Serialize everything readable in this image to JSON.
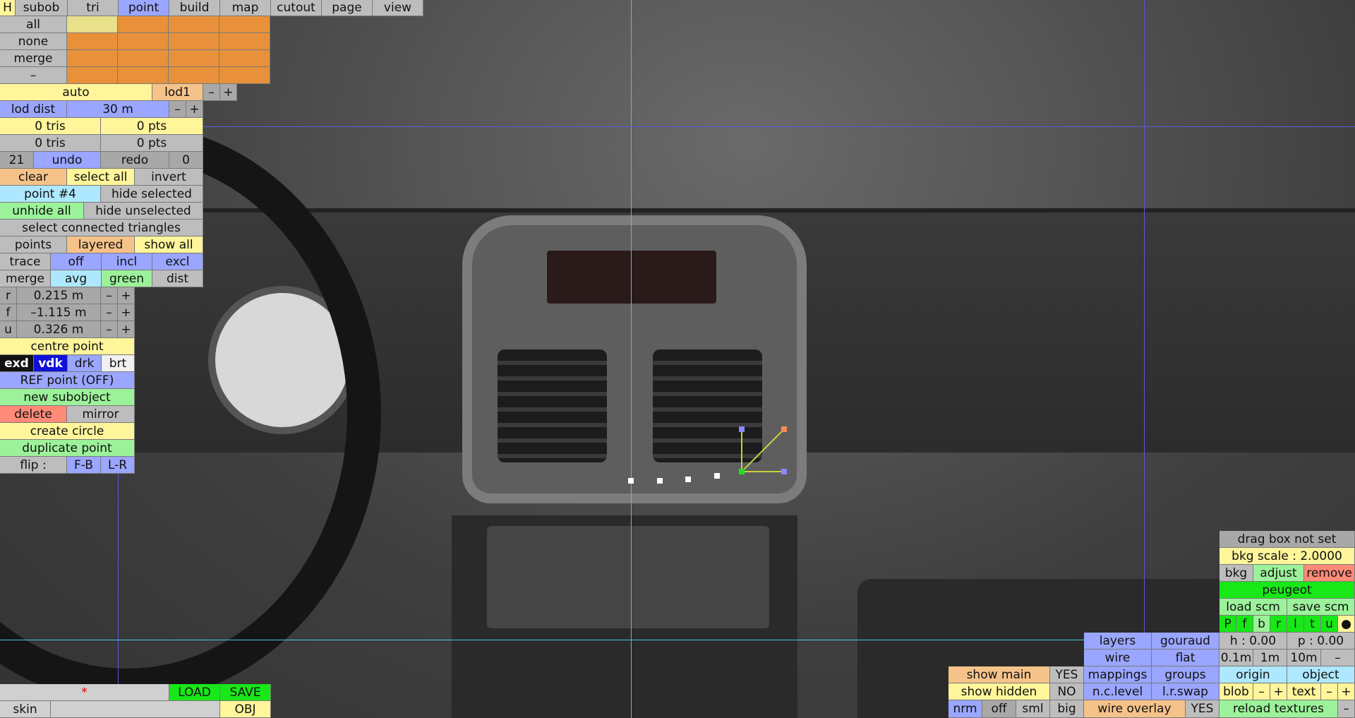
{
  "colors": {
    "cyan_guide": "#43c8d6",
    "blue_guide": "#5a5ad8",
    "point_green": "#22e022",
    "point_blue": "#8888ff",
    "point_orange": "#ff8a55",
    "line_yellow": "#c8d040"
  },
  "top_tabs": [
    "H",
    "subob",
    "tri",
    "point",
    "build",
    "map",
    "cutout",
    "page",
    "view"
  ],
  "sel_rows": [
    "all",
    "none",
    "merge",
    "–"
  ],
  "auto": "auto",
  "lod": "lod1",
  "minus": "–",
  "plus": "+",
  "lod_dist_label": "lod dist",
  "lod_dist_value": "30 m",
  "stats": [
    "0 tris",
    "0 pts",
    "0 tris",
    "0 pts"
  ],
  "undo": {
    "count": "21",
    "undo": "undo",
    "redo": "redo",
    "redo_count": "0"
  },
  "sel_btns": [
    "clear",
    "select all",
    "invert"
  ],
  "point_label": "point #4",
  "hide_selected": "hide selected",
  "unhide_all": "unhide all",
  "hide_unselected": "hide unselected",
  "select_connected": "select connected triangles",
  "points": "points",
  "layered": "layered",
  "show_all": "show all",
  "trace": "trace",
  "off": "off",
  "incl": "incl",
  "excl": "excl",
  "merge2": "merge",
  "avg": "avg",
  "green": "green",
  "dist": "dist",
  "coords": [
    {
      "axis": "r",
      "value": "0.215 m"
    },
    {
      "axis": "f",
      "value": "–1.115 m"
    },
    {
      "axis": "u",
      "value": "0.326 m"
    }
  ],
  "centre_point": "centre point",
  "shade": [
    "exd",
    "vdk",
    "drk",
    "brt"
  ],
  "ref_point": "REF point (OFF)",
  "new_subobject": "new subobject",
  "delete": "delete",
  "mirror": "mirror",
  "create_circle": "create circle",
  "duplicate_point": "duplicate point",
  "flip": "flip :",
  "fb": "F-B",
  "lr": "L-R",
  "file": {
    "star": "*",
    "load": "LOAD",
    "save": "SAVE",
    "skin": "skin",
    "obj": "OBJ"
  },
  "right": {
    "drag_box": "drag box not set",
    "bkg_scale": "bkg scale : 2.0000",
    "bkg": "bkg",
    "adjust": "adjust",
    "remove": "remove",
    "peugeot": "peugeot",
    "load_scm": "load scm",
    "save_scm": "save scm",
    "views": [
      "P",
      "f",
      "b",
      "r",
      "l",
      "t",
      "u",
      "●"
    ],
    "h": "h : 0.00",
    "p": "p : 0.00",
    "steps": [
      "0.1m",
      "1m",
      "10m",
      "–"
    ],
    "origin": "origin",
    "object": "object",
    "blob": "blob",
    "text": "text",
    "reload": "reload textures",
    "dash": "–"
  },
  "display": {
    "layers": "layers",
    "gouraud": "gouraud",
    "wire": "wire",
    "flat": "flat",
    "mappings": "mappings",
    "groups": "groups",
    "nclevel": "n.c.level",
    "lrswap": "l.r.swap",
    "wire_overlay": "wire overlay",
    "yes": "YES",
    "no": "NO",
    "show_main": "show main",
    "show_hidden": "show hidden",
    "nrm": "nrm",
    "off": "off",
    "sml": "sml",
    "big": "big"
  }
}
